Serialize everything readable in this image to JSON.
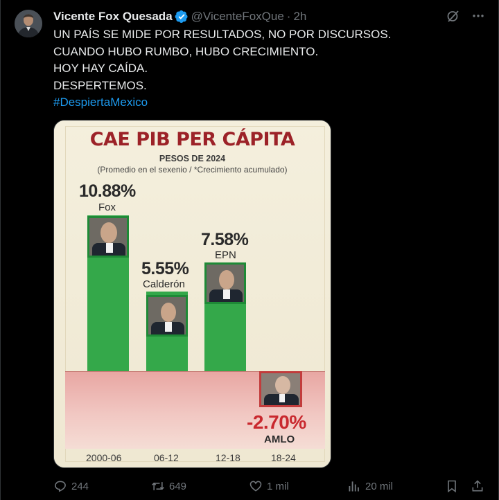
{
  "author": {
    "name": "Vicente Fox Quesada",
    "handle": "@VicenteFoxQue",
    "separator": "·",
    "time": "2h"
  },
  "tweet": {
    "lines": [
      "UN PAÍS SE MIDE POR RESULTADOS, NO POR DISCURSOS.",
      "CUANDO HUBO RUMBO, HUBO CRECIMIENTO.",
      "HOY HAY CAÍDA.",
      "DESPERTEMOS."
    ],
    "hashtag": "#DespiertaMexico"
  },
  "icons": {
    "grok": "grok-icon",
    "more": "more-icon",
    "reply": "reply-icon",
    "retweet": "retweet-icon",
    "like": "like-icon",
    "views": "views-icon",
    "bookmark": "bookmark-icon",
    "share": "share-icon"
  },
  "metrics": {
    "replies": "244",
    "retweets": "649",
    "likes": "1 mil",
    "views": "20 mil"
  },
  "colors": {
    "link": "#1d9bf0",
    "verified": "#1d9bf0",
    "bar_positive": "#34a84a",
    "bar_negative": "#d94b4b",
    "chart_title": "#9c2228"
  },
  "chart_data": {
    "type": "bar",
    "title": "CAE PIB PER CÁPITA",
    "subtitle": "PESOS DE 2024",
    "note": "(Promedio en el sexenio / *Crecimiento acumulado)",
    "categories": [
      "2000-06",
      "06-12",
      "12-18",
      "18-24"
    ],
    "names": [
      "Fox",
      "Calderón",
      "EPN",
      "AMLO"
    ],
    "value_labels": [
      "10.88%",
      "5.55%",
      "7.58%",
      "-2.70%"
    ],
    "values": [
      10.88,
      5.55,
      7.58,
      -2.7
    ]
  }
}
